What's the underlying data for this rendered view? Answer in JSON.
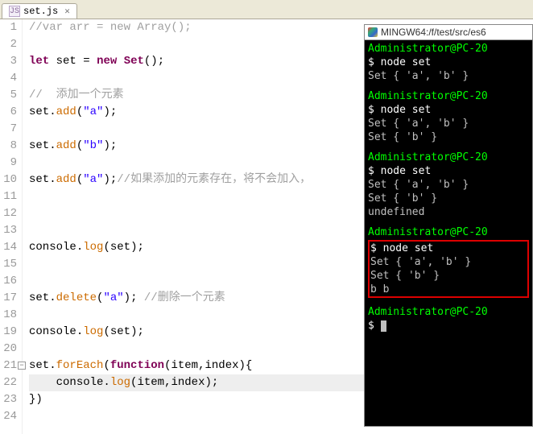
{
  "tab": {
    "filename": "set.js",
    "close_glyph": "✕"
  },
  "editor": {
    "lines": [
      {
        "n": 1,
        "tokens": [
          {
            "cls": "c-comment",
            "t": "//var arr = new Array();"
          }
        ]
      },
      {
        "n": 2,
        "tokens": []
      },
      {
        "n": 3,
        "tokens": [
          {
            "cls": "c-keyword",
            "t": "let"
          },
          {
            "cls": "c-punct",
            "t": " "
          },
          {
            "cls": "c-ident",
            "t": "set"
          },
          {
            "cls": "c-punct",
            "t": " = "
          },
          {
            "cls": "c-keyword",
            "t": "new"
          },
          {
            "cls": "c-punct",
            "t": " "
          },
          {
            "cls": "c-class",
            "t": "Set"
          },
          {
            "cls": "c-punct",
            "t": "();"
          }
        ]
      },
      {
        "n": 4,
        "tokens": []
      },
      {
        "n": 5,
        "tokens": [
          {
            "cls": "c-comment",
            "t": "//  添加一个元素"
          }
        ]
      },
      {
        "n": 6,
        "tokens": [
          {
            "cls": "c-ident",
            "t": "set"
          },
          {
            "cls": "c-punct",
            "t": "."
          },
          {
            "cls": "c-method",
            "t": "add"
          },
          {
            "cls": "c-punct",
            "t": "("
          },
          {
            "cls": "c-string",
            "t": "\"a\""
          },
          {
            "cls": "c-punct",
            "t": ");"
          }
        ]
      },
      {
        "n": 7,
        "tokens": []
      },
      {
        "n": 8,
        "tokens": [
          {
            "cls": "c-ident",
            "t": "set"
          },
          {
            "cls": "c-punct",
            "t": "."
          },
          {
            "cls": "c-method",
            "t": "add"
          },
          {
            "cls": "c-punct",
            "t": "("
          },
          {
            "cls": "c-string",
            "t": "\"b\""
          },
          {
            "cls": "c-punct",
            "t": ");"
          }
        ]
      },
      {
        "n": 9,
        "tokens": []
      },
      {
        "n": 10,
        "tokens": [
          {
            "cls": "c-ident",
            "t": "set"
          },
          {
            "cls": "c-punct",
            "t": "."
          },
          {
            "cls": "c-method",
            "t": "add"
          },
          {
            "cls": "c-punct",
            "t": "("
          },
          {
            "cls": "c-string",
            "t": "\"a\""
          },
          {
            "cls": "c-punct",
            "t": ");"
          },
          {
            "cls": "c-comment",
            "t": "//如果添加的元素存在，将不会加入，"
          }
        ]
      },
      {
        "n": 11,
        "tokens": []
      },
      {
        "n": 12,
        "tokens": []
      },
      {
        "n": 13,
        "tokens": []
      },
      {
        "n": 14,
        "tokens": [
          {
            "cls": "c-ident",
            "t": "console"
          },
          {
            "cls": "c-punct",
            "t": "."
          },
          {
            "cls": "c-method",
            "t": "log"
          },
          {
            "cls": "c-punct",
            "t": "("
          },
          {
            "cls": "c-ident",
            "t": "set"
          },
          {
            "cls": "c-punct",
            "t": ");"
          }
        ]
      },
      {
        "n": 15,
        "tokens": []
      },
      {
        "n": 16,
        "tokens": []
      },
      {
        "n": 17,
        "tokens": [
          {
            "cls": "c-ident",
            "t": "set"
          },
          {
            "cls": "c-punct",
            "t": "."
          },
          {
            "cls": "c-method",
            "t": "delete"
          },
          {
            "cls": "c-punct",
            "t": "("
          },
          {
            "cls": "c-string",
            "t": "\"a\""
          },
          {
            "cls": "c-punct",
            "t": "); "
          },
          {
            "cls": "c-comment",
            "t": "//删除一个元素"
          }
        ]
      },
      {
        "n": 18,
        "tokens": []
      },
      {
        "n": 19,
        "tokens": [
          {
            "cls": "c-ident",
            "t": "console"
          },
          {
            "cls": "c-punct",
            "t": "."
          },
          {
            "cls": "c-method",
            "t": "log"
          },
          {
            "cls": "c-punct",
            "t": "("
          },
          {
            "cls": "c-ident",
            "t": "set"
          },
          {
            "cls": "c-punct",
            "t": ");"
          }
        ]
      },
      {
        "n": 20,
        "tokens": []
      },
      {
        "n": 21,
        "fold": true,
        "tokens": [
          {
            "cls": "c-ident",
            "t": "set"
          },
          {
            "cls": "c-punct",
            "t": "."
          },
          {
            "cls": "c-method",
            "t": "forEach"
          },
          {
            "cls": "c-punct",
            "t": "("
          },
          {
            "cls": "c-keyword",
            "t": "function"
          },
          {
            "cls": "c-punct",
            "t": "("
          },
          {
            "cls": "c-ident",
            "t": "item"
          },
          {
            "cls": "c-punct",
            "t": ","
          },
          {
            "cls": "c-ident",
            "t": "index"
          },
          {
            "cls": "c-punct",
            "t": "){"
          }
        ]
      },
      {
        "n": 22,
        "highlight": true,
        "tokens": [
          {
            "cls": "c-punct",
            "t": "    "
          },
          {
            "cls": "c-ident",
            "t": "console"
          },
          {
            "cls": "c-punct",
            "t": "."
          },
          {
            "cls": "c-method",
            "t": "log"
          },
          {
            "cls": "c-punct",
            "t": "("
          },
          {
            "cls": "c-ident",
            "t": "item"
          },
          {
            "cls": "c-punct",
            "t": ","
          },
          {
            "cls": "c-ident",
            "t": "index"
          },
          {
            "cls": "c-punct",
            "t": ");"
          }
        ]
      },
      {
        "n": 23,
        "tokens": [
          {
            "cls": "c-punct",
            "t": "})"
          }
        ]
      },
      {
        "n": 24,
        "tokens": []
      }
    ]
  },
  "terminal": {
    "title": "MINGW64:/f/test/src/es6",
    "blocks": [
      {
        "boxed": false,
        "lines": [
          {
            "cls": "t-green",
            "t": "Administrator@PC-20"
          },
          {
            "cls": "t-white",
            "t": "$ node set"
          },
          {
            "cls": "t-silver",
            "t": "Set { 'a', 'b' }"
          }
        ]
      },
      {
        "boxed": false,
        "lines": [
          {
            "cls": "t-green",
            "t": "Administrator@PC-20"
          },
          {
            "cls": "t-white",
            "t": "$ node set"
          },
          {
            "cls": "t-silver",
            "t": "Set { 'a', 'b' }"
          },
          {
            "cls": "t-silver",
            "t": "Set { 'b' }"
          }
        ]
      },
      {
        "boxed": false,
        "lines": [
          {
            "cls": "t-green",
            "t": "Administrator@PC-20"
          },
          {
            "cls": "t-white",
            "t": "$ node set"
          },
          {
            "cls": "t-silver",
            "t": "Set { 'a', 'b' }"
          },
          {
            "cls": "t-silver",
            "t": "Set { 'b' }"
          },
          {
            "cls": "t-silver",
            "t": "undefined"
          }
        ]
      },
      {
        "boxed": true,
        "header": {
          "cls": "t-green",
          "t": "Administrator@PC-20"
        },
        "lines": [
          {
            "cls": "t-white",
            "t": "$ node set"
          },
          {
            "cls": "t-silver",
            "t": "Set { 'a', 'b' }"
          },
          {
            "cls": "t-silver",
            "t": "Set { 'b' }"
          },
          {
            "cls": "t-silver",
            "t": "b b"
          }
        ]
      },
      {
        "boxed": false,
        "lines": [
          {
            "cls": "t-green",
            "t": "Administrator@PC-20"
          },
          {
            "cls": "t-white",
            "t": "$ ",
            "cursor": true
          }
        ]
      }
    ]
  }
}
